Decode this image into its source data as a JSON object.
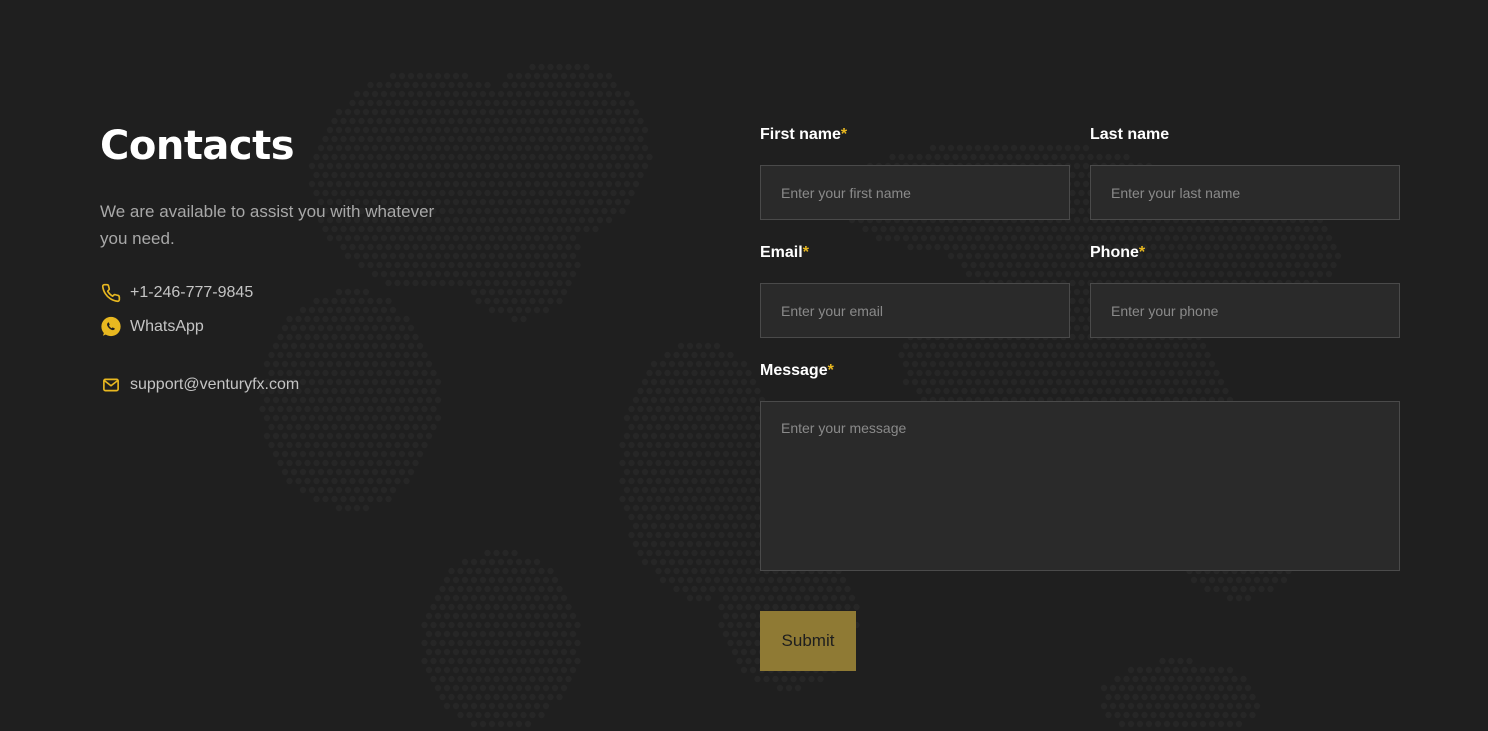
{
  "contacts": {
    "title": "Contacts",
    "intro": "We are available to assist you with whatever you need.",
    "phone": "+1-246-777-9845",
    "whatsapp": "WhatsApp",
    "email": "support@venturyfx.com"
  },
  "form": {
    "first_name": {
      "label": "First name",
      "required": "*",
      "placeholder": "Enter your first name"
    },
    "last_name": {
      "label": "Last name",
      "placeholder": "Enter your last name"
    },
    "email": {
      "label": "Email",
      "required": "*",
      "placeholder": "Enter your email"
    },
    "phone": {
      "label": "Phone",
      "required": "*",
      "placeholder": "Enter your phone"
    },
    "message": {
      "label": "Message",
      "required": "*",
      "placeholder": "Enter your message"
    },
    "submit_label": "Submit"
  },
  "icons": {
    "phone": "phone-icon",
    "whatsapp": "whatsapp-icon",
    "email": "mail-icon"
  },
  "colors": {
    "background": "#1f1f1f",
    "accent": "#e8b820",
    "submit_bg": "#8f7a34",
    "field_bg": "#2a2a2a"
  }
}
